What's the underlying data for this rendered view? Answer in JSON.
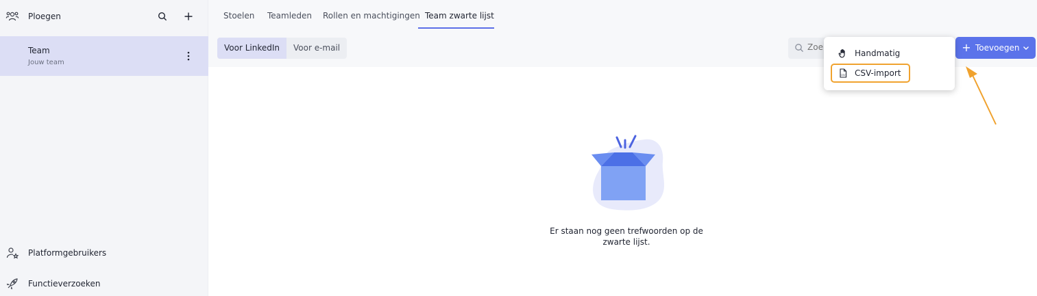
{
  "sidebar": {
    "header": {
      "title": "Ploegen",
      "icon": "team-icon",
      "search_icon": "search-icon",
      "add_icon": "plus-icon"
    },
    "selected_team": {
      "name": "Team",
      "subtitle": "Jouw team",
      "menu_icon": "more-vertical-icon"
    },
    "bottom_items": [
      {
        "label": "Platformgebruikers",
        "icon": "user-star-icon"
      },
      {
        "label": "Functieverzoeken",
        "icon": "rocket-icon"
      }
    ]
  },
  "tabs": [
    {
      "label": "Stoelen",
      "active": false
    },
    {
      "label": "Teamleden",
      "active": false
    },
    {
      "label": "Rollen en machtigingen",
      "active": false
    },
    {
      "label": "Team zwarte lijst",
      "active": true
    }
  ],
  "toolbar": {
    "segments": [
      {
        "label": "Voor LinkedIn",
        "selected": true
      },
      {
        "label": "Voor e-mail",
        "selected": false
      }
    ],
    "search": {
      "placeholder": "Zoe",
      "icon": "search-icon"
    },
    "add_button": {
      "label": "Toevoegen",
      "icon": "plus-icon",
      "caret": "chevron-down-icon"
    }
  },
  "dropdown": {
    "items": [
      {
        "label": "Handmatig",
        "icon": "hand-icon",
        "highlighted": false
      },
      {
        "label": "CSV-import",
        "icon": "csv-file-icon",
        "highlighted": true
      }
    ]
  },
  "empty_state": {
    "illustration": "open-box-icon",
    "message": "Er staan nog geen trefwoorden op de zwarte lijst."
  },
  "colors": {
    "accent": "#5b73ea",
    "highlight": "#f0a22e",
    "selected_bg": "#dcdef5",
    "sidebar_bg": "#f4f5f8"
  }
}
